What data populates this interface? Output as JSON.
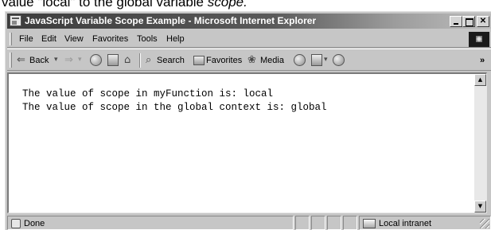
{
  "caption": {
    "prefix": "value \"local\" to the global variable ",
    "emphasis": "scope."
  },
  "window": {
    "title": "JavaScript Variable Scope Example - Microsoft Internet Explorer"
  },
  "menu": {
    "items": [
      "File",
      "Edit",
      "View",
      "Favorites",
      "Tools",
      "Help"
    ]
  },
  "toolbar": {
    "back_label": "Back",
    "search_label": "Search",
    "favorites_label": "Favorites",
    "media_label": "Media",
    "more_label": "»"
  },
  "page": {
    "lines": [
      "The value of scope in myFunction is: local",
      "The value of scope in the global context is: global"
    ]
  },
  "status": {
    "text": "Done",
    "zone": "Local intranet"
  }
}
